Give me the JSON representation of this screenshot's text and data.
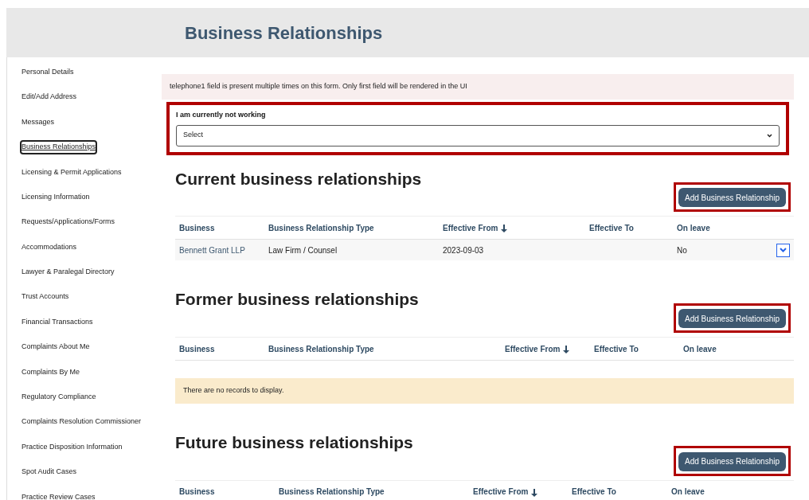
{
  "header": {
    "title": "Business Relationships"
  },
  "sidebar": {
    "items": [
      {
        "label": "Personal Details",
        "selected": false
      },
      {
        "label": "Edit/Add Address",
        "selected": false
      },
      {
        "label": "Messages",
        "selected": false
      },
      {
        "label": "Business Relationships",
        "selected": true
      },
      {
        "label": "Licensing & Permit Applications",
        "selected": false
      },
      {
        "label": "Licensing Information",
        "selected": false
      },
      {
        "label": "Requests/Applications/Forms",
        "selected": false
      },
      {
        "label": "Accommodations",
        "selected": false
      },
      {
        "label": "Lawyer & Paralegal Directory",
        "selected": false
      },
      {
        "label": "Trust Accounts",
        "selected": false
      },
      {
        "label": "Financial Transactions",
        "selected": false
      },
      {
        "label": "Complaints About Me",
        "selected": false
      },
      {
        "label": "Complaints By Me",
        "selected": false
      },
      {
        "label": "Regulatory Compliance",
        "selected": false
      },
      {
        "label": "Complaints Resolution Commissioner",
        "selected": false
      },
      {
        "label": "Practice Disposition Information",
        "selected": false
      },
      {
        "label": "Spot Audit Cases",
        "selected": false
      },
      {
        "label": "Practice Review Cases",
        "selected": false
      }
    ]
  },
  "alert": "telephone1 field is present multiple times on this form. Only first field will be rendered in the UI",
  "working_field": {
    "label": "I am currently not working",
    "value": "Select",
    "highlighted": true
  },
  "sections": [
    {
      "title": "Current business relationships",
      "button": {
        "label": "Add Business Relationship",
        "highlighted": true
      },
      "columns": [
        {
          "label": "Business",
          "sorted": false
        },
        {
          "label": "Business Relationship Type",
          "sorted": false
        },
        {
          "label": "Effective From",
          "sorted": true
        },
        {
          "label": "Effective To",
          "sorted": false
        },
        {
          "label": "On leave",
          "sorted": false
        }
      ],
      "rows": [
        {
          "business": "Bennett Grant LLP",
          "type": "Law Firm / Counsel",
          "effective_from": "2023-09-03",
          "on_leave": "No"
        }
      ]
    },
    {
      "title": "Former business relationships",
      "button": {
        "label": "Add Business Relationship",
        "highlighted": true
      },
      "columns": [
        {
          "label": "Business",
          "sorted": false
        },
        {
          "label": "Business Relationship Type",
          "sorted": false
        },
        {
          "label": "Effective From",
          "sorted": true
        },
        {
          "label": "Effective To",
          "sorted": false
        },
        {
          "label": "On leave",
          "sorted": false
        }
      ],
      "empty_message": "There are no records to display."
    },
    {
      "title": "Future business relationships",
      "button": {
        "label": "Add Business Relationship",
        "highlighted": true
      },
      "columns": [
        {
          "label": "Business",
          "sorted": false
        },
        {
          "label": "Business Relationship Type",
          "sorted": false
        },
        {
          "label": "Effective From",
          "sorted": true
        },
        {
          "label": "Effective To",
          "sorted": false
        },
        {
          "label": "On leave",
          "sorted": false
        }
      ]
    }
  ]
}
